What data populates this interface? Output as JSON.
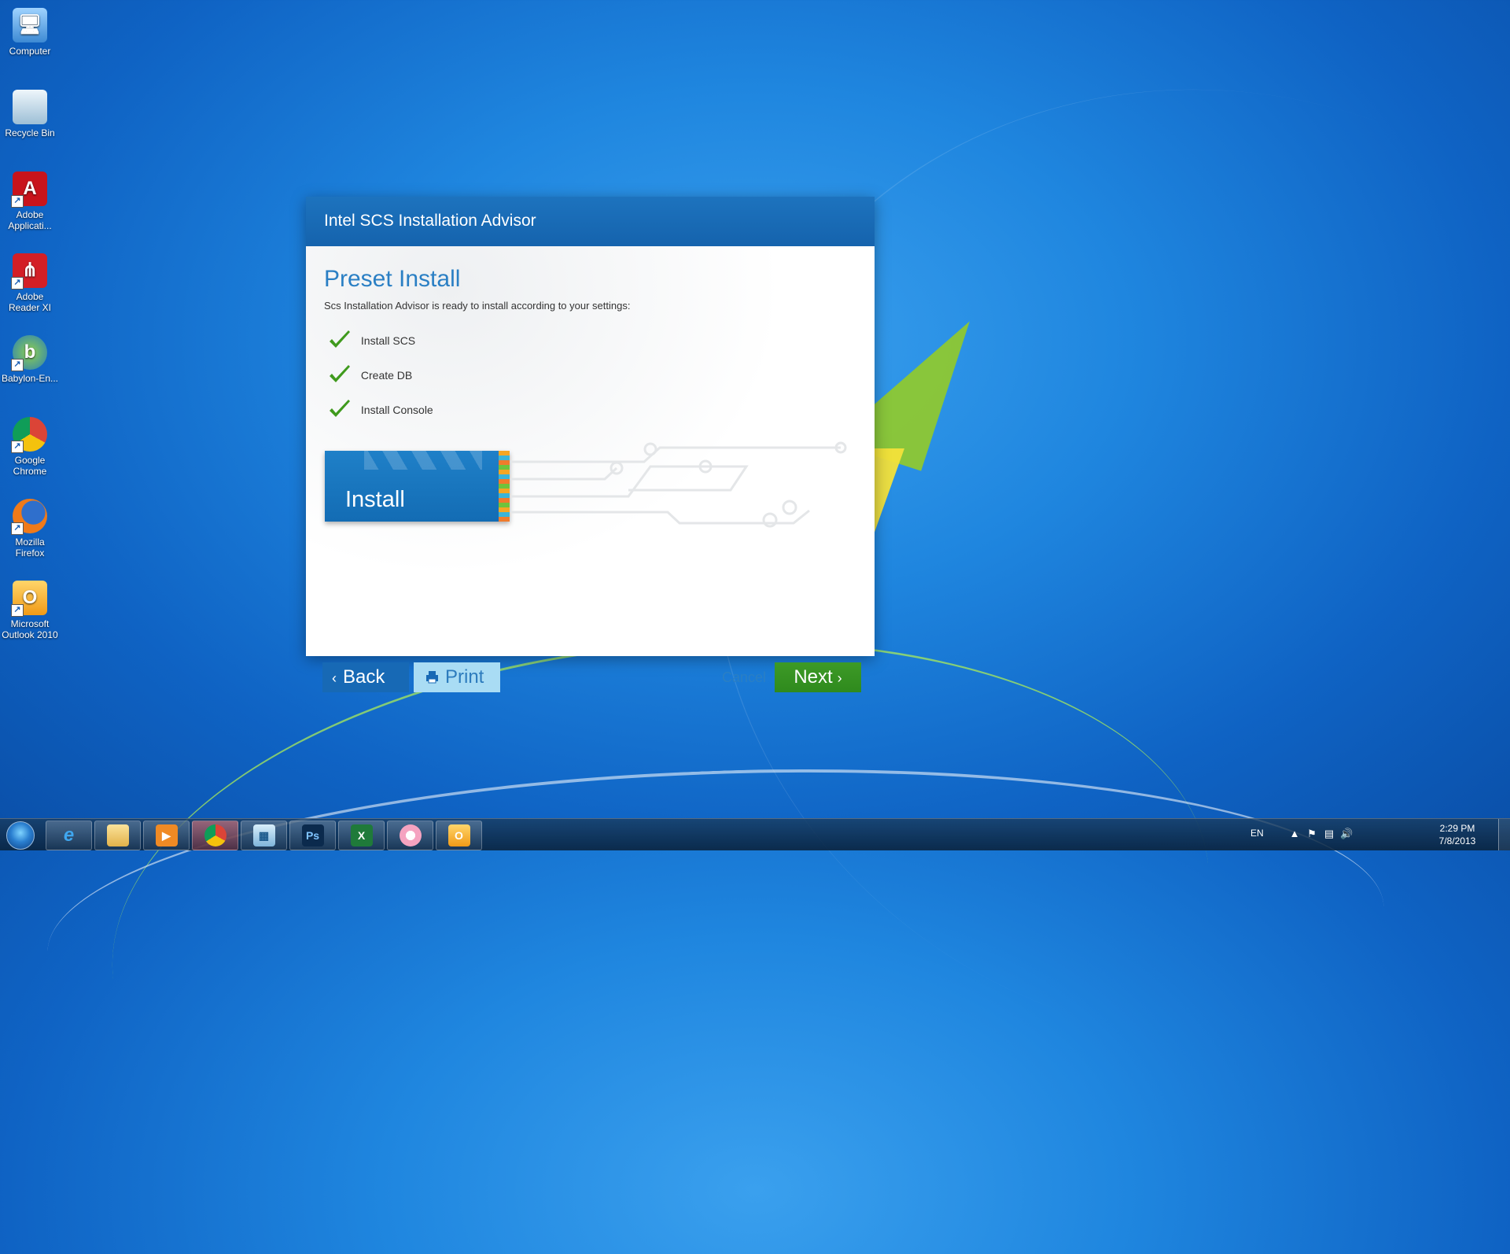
{
  "desktop": {
    "icons": [
      {
        "label_line1": "Computer",
        "label_line2": "",
        "icon": "computer-icon"
      },
      {
        "label_line1": "Recycle Bin",
        "label_line2": "",
        "icon": "recycle-bin-icon"
      },
      {
        "label_line1": "Adobe",
        "label_line2": "Applicati...",
        "icon": "adobe-app-manager-icon"
      },
      {
        "label_line1": "Adobe",
        "label_line2": "Reader XI",
        "icon": "adobe-reader-icon"
      },
      {
        "label_line1": "Babylon-En...",
        "label_line2": "",
        "icon": "babylon-icon"
      },
      {
        "label_line1": "Google",
        "label_line2": "Chrome",
        "icon": "chrome-icon"
      },
      {
        "label_line1": "Mozilla",
        "label_line2": "Firefox",
        "icon": "firefox-icon"
      },
      {
        "label_line1": "Microsoft",
        "label_line2": "Outlook 2010",
        "icon": "outlook-icon"
      }
    ]
  },
  "dialog": {
    "title": "Intel SCS Installation Advisor",
    "step_title": "Preset Install",
    "description": "Scs Installation Advisor is ready to install according to your settings:",
    "items": [
      {
        "label": "Install SCS",
        "checked": true
      },
      {
        "label": "Create DB",
        "checked": true
      },
      {
        "label": "Install Console",
        "checked": true
      }
    ],
    "banner_label": "Install",
    "buttons": {
      "back": "Back",
      "print": "Print",
      "cancel": "Cancel",
      "next": "Next"
    },
    "colors": {
      "header": "#1563ad",
      "accent": "#2a7fc4",
      "next": "#2f8a1d",
      "check": "#3f9a1d"
    }
  },
  "taskbar": {
    "pinned": [
      "internet-explorer-icon",
      "file-explorer-icon",
      "media-player-icon",
      "chrome-icon",
      "network-app-icon",
      "photoshop-icon",
      "excel-icon",
      "paint-icon",
      "outlook-icon"
    ],
    "photoshop_label": "Ps",
    "excel_label": "X",
    "language": "EN",
    "time": "2:29 PM",
    "date": "7/8/2013"
  }
}
